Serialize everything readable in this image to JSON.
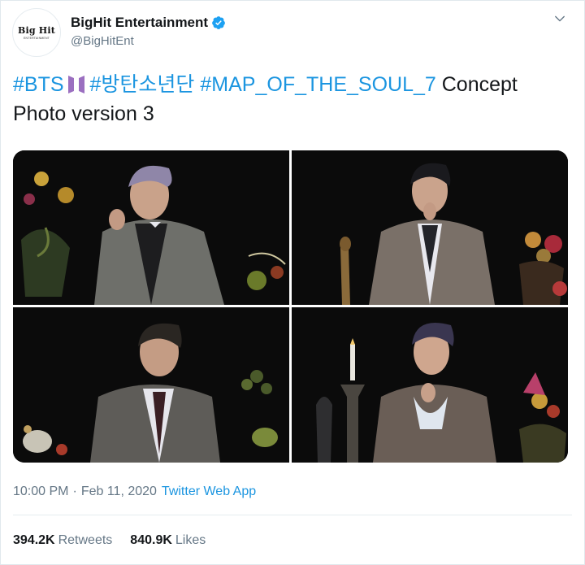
{
  "account": {
    "display_name": "BigHit Entertainment",
    "handle": "@BigHitEnt",
    "avatar_text": "Big Hit",
    "avatar_subtext": "ENTERTAINMENT",
    "verified_icon": "verified-badge-icon",
    "verified_color": "#1da1f2"
  },
  "tweet": {
    "hashtag_bts": "#BTS",
    "hashtag_korean": "#방탄소년단",
    "hashtag_album": "#MAP_OF_THE_SOUL_7",
    "text_rest": " Concept Photo version 3",
    "hashtag_color": "#1b95e0",
    "emoji_color": "#9b6fc0"
  },
  "media": {
    "photos": [
      {
        "subject": "member in grey plaid suit, flowers left"
      },
      {
        "subject": "member in tweed jacket, fruit right"
      },
      {
        "subject": "member in grey suit with tie"
      },
      {
        "subject": "member in tweed jacket, candle"
      }
    ]
  },
  "meta": {
    "time": "10:00 PM",
    "date": "Feb 11, 2020",
    "separator": "·",
    "source": "Twitter Web App"
  },
  "stats": {
    "retweets_count": "394.2K",
    "retweets_label": "Retweets",
    "likes_count": "840.9K",
    "likes_label": "Likes"
  }
}
